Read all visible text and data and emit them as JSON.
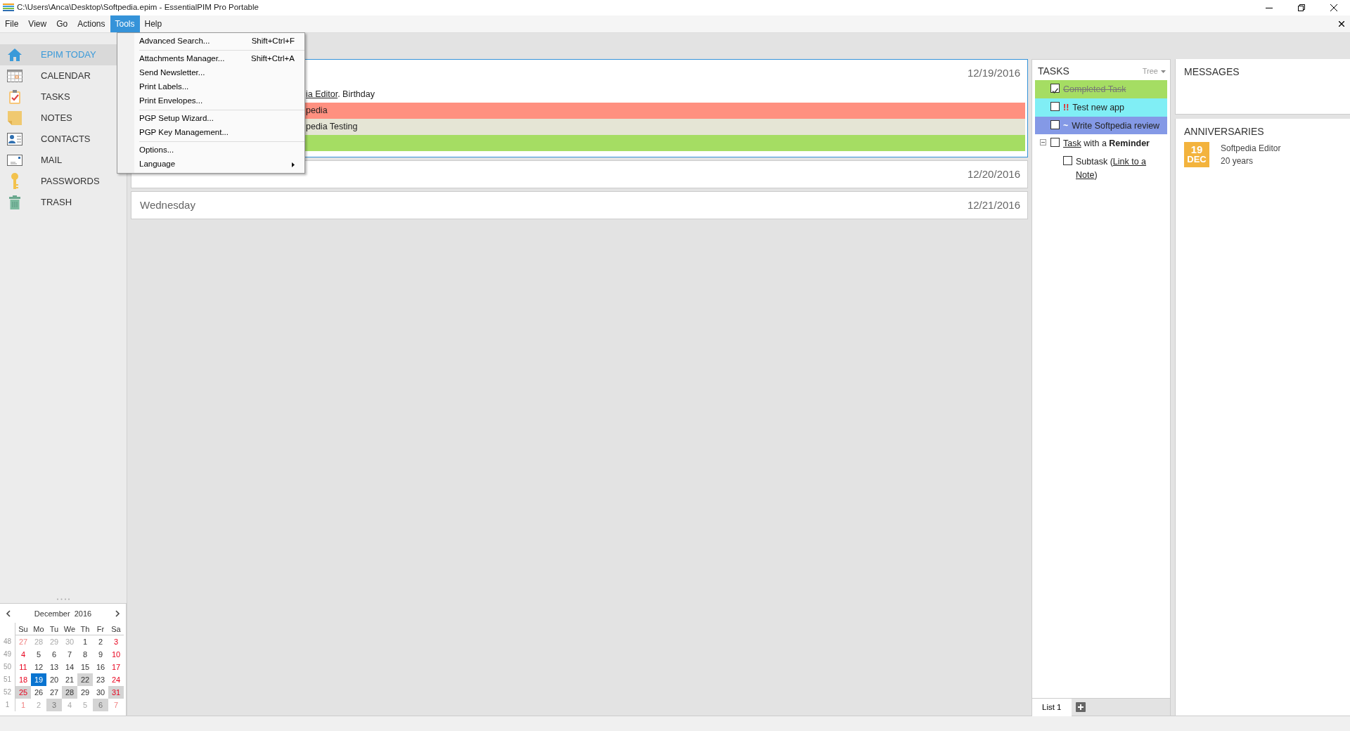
{
  "window": {
    "title": "C:\\Users\\Anca\\Desktop\\Softpedia.epim - EssentialPIM Pro Portable"
  },
  "menu": [
    {
      "label": "File",
      "selected": false
    },
    {
      "label": "View",
      "selected": false
    },
    {
      "label": "Go",
      "selected": false
    },
    {
      "label": "Actions",
      "selected": false
    },
    {
      "label": "Tools",
      "selected": true
    },
    {
      "label": "Help",
      "selected": false
    }
  ],
  "tools_menu": [
    {
      "kind": "item",
      "label": "Advanced Search...",
      "shortcut": "Shift+Ctrl+F"
    },
    {
      "kind": "separator"
    },
    {
      "kind": "item",
      "label": "Attachments Manager...",
      "shortcut": "Shift+Ctrl+A"
    },
    {
      "kind": "item",
      "label": "Send Newsletter..."
    },
    {
      "kind": "item",
      "label": "Print Labels..."
    },
    {
      "kind": "item",
      "label": "Print Envelopes..."
    },
    {
      "kind": "separator"
    },
    {
      "kind": "item",
      "label": "PGP Setup Wizard..."
    },
    {
      "kind": "item",
      "label": "PGP Key Management..."
    },
    {
      "kind": "separator"
    },
    {
      "kind": "item",
      "label": "Options..."
    },
    {
      "kind": "submenu",
      "label": "Language"
    }
  ],
  "sidebar": {
    "items": [
      {
        "label": "EPIM TODAY",
        "selected": true
      },
      {
        "label": "CALENDAR",
        "selected": false
      },
      {
        "label": "TASKS",
        "selected": false
      },
      {
        "label": "NOTES",
        "selected": false
      },
      {
        "label": "CONTACTS",
        "selected": false
      },
      {
        "label": "MAIL",
        "selected": false
      },
      {
        "label": "PASSWORDS",
        "selected": false
      },
      {
        "label": "TRASH",
        "selected": false
      }
    ]
  },
  "days": [
    {
      "date": "12/19/2016",
      "selected": true,
      "entries": [
        {
          "parts": [
            {
              "kind": "link",
              "text": "ia Editor"
            },
            {
              "kind": "text",
              "text": ". Birthday"
            }
          ]
        },
        {
          "color": "#ff9080",
          "parts": [
            {
              "kind": "text",
              "text": "pedia"
            }
          ]
        },
        {
          "color": "#e5e5d5",
          "parts": [
            {
              "kind": "text",
              "text": "pedia Testing"
            }
          ]
        },
        {
          "color": "#a5dd63"
        }
      ]
    },
    {
      "date": "12/20/2016",
      "selected": false
    },
    {
      "heading": "Wednesday",
      "date": "12/21/2016",
      "selected": false
    }
  ],
  "tasks": {
    "title": "TASKS",
    "view": "Tree",
    "items": [
      {
        "checked": true,
        "color": "#a5dd63",
        "parts": [
          {
            "kind": "text",
            "text": "Completed Task"
          }
        ]
      },
      {
        "checked": false,
        "color": "#80eef5",
        "marker": "!!",
        "parts": [
          {
            "kind": "text",
            "text": "Test new app"
          }
        ]
      },
      {
        "checked": false,
        "color": "#8499e6",
        "marker": "~",
        "parts": [
          {
            "kind": "text",
            "text": "Write Softpedia review"
          }
        ]
      },
      {
        "checked": false,
        "expanded": true,
        "parts": [
          {
            "kind": "link",
            "text": "Task"
          },
          {
            "kind": "text",
            "text": " with a **Reminder**"
          }
        ],
        "children": [
          {
            "checked": false,
            "parts": [
              {
                "kind": "text",
                "text": "Subtask ("
              },
              {
                "kind": "link",
                "text": "Link to a"
              },
              {
                "kind": "link",
                "text": "Note"
              },
              {
                "kind": "text",
                "text": ")"
              }
            ]
          }
        ]
      }
    ],
    "lists": [
      {
        "label": "List 1",
        "selected": true
      }
    ]
  },
  "messages": {
    "title": "MESSAGES"
  },
  "anniversaries": {
    "title": "ANNIVERSARIES",
    "items": [
      {
        "day": "19",
        "month": "DEC",
        "name": "Softpedia Editor",
        "years": "20 years"
      }
    ]
  },
  "mini_calendar": {
    "title": "December  2016",
    "weekdays": [
      "Su",
      "Mo",
      "Tu",
      "We",
      "Th",
      "Fr",
      "Sa"
    ],
    "weeks": [
      {
        "no": "48",
        "days": [
          {
            "t": "27",
            "other": true,
            "marked": false,
            "selected": false
          },
          {
            "t": "28",
            "other": true,
            "marked": false,
            "selected": false
          },
          {
            "t": "29",
            "other": true,
            "marked": false,
            "selected": false
          },
          {
            "t": "30",
            "other": true,
            "marked": false,
            "selected": false
          },
          {
            "t": "1",
            "other": false,
            "marked": false,
            "selected": false
          },
          {
            "t": "2",
            "other": false,
            "marked": false,
            "selected": false
          },
          {
            "t": "3",
            "other": false,
            "marked": false,
            "selected": false
          }
        ]
      },
      {
        "no": "49",
        "days": [
          {
            "t": "4",
            "other": false,
            "marked": false,
            "selected": false
          },
          {
            "t": "5",
            "other": false,
            "marked": false,
            "selected": false
          },
          {
            "t": "6",
            "other": false,
            "marked": false,
            "selected": false
          },
          {
            "t": "7",
            "other": false,
            "marked": false,
            "selected": false
          },
          {
            "t": "8",
            "other": false,
            "marked": false,
            "selected": false
          },
          {
            "t": "9",
            "other": false,
            "marked": false,
            "selected": false
          },
          {
            "t": "10",
            "other": false,
            "marked": false,
            "selected": false
          }
        ]
      },
      {
        "no": "50",
        "days": [
          {
            "t": "11",
            "other": false,
            "marked": false,
            "selected": false
          },
          {
            "t": "12",
            "other": false,
            "marked": false,
            "selected": false
          },
          {
            "t": "13",
            "other": false,
            "marked": false,
            "selected": false
          },
          {
            "t": "14",
            "other": false,
            "marked": false,
            "selected": false
          },
          {
            "t": "15",
            "other": false,
            "marked": false,
            "selected": false
          },
          {
            "t": "16",
            "other": false,
            "marked": false,
            "selected": false
          },
          {
            "t": "17",
            "other": false,
            "marked": false,
            "selected": false
          }
        ]
      },
      {
        "no": "51",
        "days": [
          {
            "t": "18",
            "other": false,
            "marked": false,
            "selected": false
          },
          {
            "t": "19",
            "other": false,
            "marked": false,
            "selected": true
          },
          {
            "t": "20",
            "other": false,
            "marked": false,
            "selected": false
          },
          {
            "t": "21",
            "other": false,
            "marked": false,
            "selected": false
          },
          {
            "t": "22",
            "other": false,
            "marked": true,
            "selected": false
          },
          {
            "t": "23",
            "other": false,
            "marked": false,
            "selected": false
          },
          {
            "t": "24",
            "other": false,
            "marked": false,
            "selected": false
          }
        ]
      },
      {
        "no": "52",
        "days": [
          {
            "t": "25",
            "other": false,
            "marked": true,
            "selected": false
          },
          {
            "t": "26",
            "other": false,
            "marked": false,
            "selected": false
          },
          {
            "t": "27",
            "other": false,
            "marked": false,
            "selected": false
          },
          {
            "t": "28",
            "other": false,
            "marked": true,
            "selected": false
          },
          {
            "t": "29",
            "other": false,
            "marked": false,
            "selected": false
          },
          {
            "t": "30",
            "other": false,
            "marked": false,
            "selected": false
          },
          {
            "t": "31",
            "other": false,
            "marked": true,
            "selected": false
          }
        ]
      },
      {
        "no": "1",
        "days": [
          {
            "t": "1",
            "other": true,
            "marked": false,
            "selected": false
          },
          {
            "t": "2",
            "other": true,
            "marked": false,
            "selected": false
          },
          {
            "t": "3",
            "other": true,
            "marked": true,
            "selected": false
          },
          {
            "t": "4",
            "other": true,
            "marked": false,
            "selected": false
          },
          {
            "t": "5",
            "other": true,
            "marked": false,
            "selected": false
          },
          {
            "t": "6",
            "other": true,
            "marked": true,
            "selected": false
          },
          {
            "t": "7",
            "other": true,
            "marked": false,
            "selected": false
          }
        ]
      }
    ]
  }
}
